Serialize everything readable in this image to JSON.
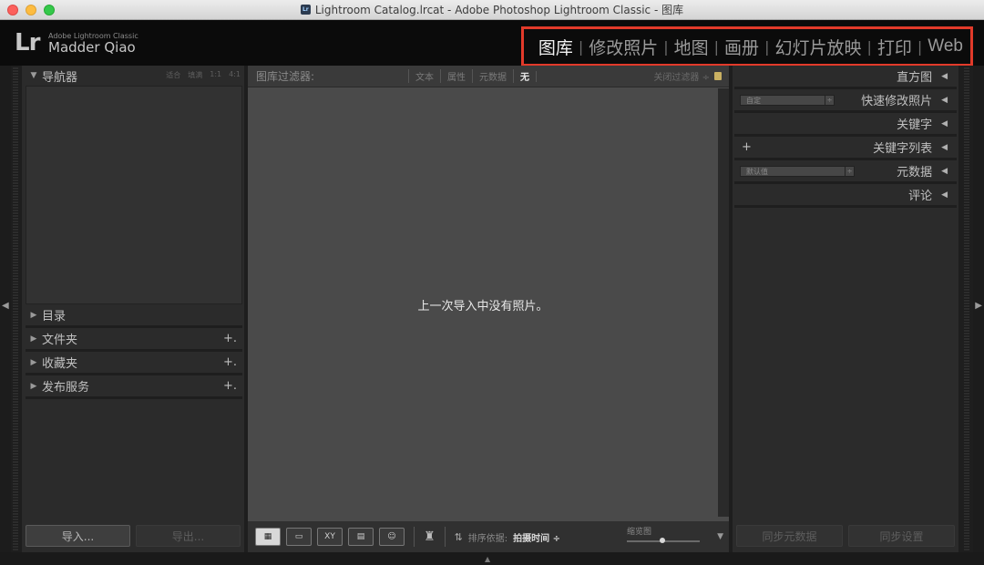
{
  "window": {
    "title": "Lightroom Catalog.lrcat - Adobe Photoshop Lightroom Classic - 图库",
    "icon": "lr-icon"
  },
  "identity": {
    "logo": "Lr",
    "product": "Adobe Lightroom Classic",
    "user": "Madder Qiao"
  },
  "modules": [
    "图库",
    "修改照片",
    "地图",
    "画册",
    "幻灯片放映",
    "打印",
    "Web"
  ],
  "active_module": "图库",
  "left_panel": {
    "navigator": {
      "label": "导航器",
      "options": [
        "适合",
        "填满",
        "1:1",
        "4:1"
      ]
    },
    "sections": [
      {
        "label": "目录",
        "has_add": false
      },
      {
        "label": "文件夹",
        "has_add": true
      },
      {
        "label": "收藏夹",
        "has_add": true
      },
      {
        "label": "发布服务",
        "has_add": true
      }
    ],
    "plus": "+.",
    "import_label": "导入...",
    "export_label": "导出..."
  },
  "filter_bar": {
    "title": "图库过滤器:",
    "options": [
      "文本",
      "属性",
      "元数据",
      "无"
    ],
    "selected": "无",
    "close_label": "关闭过滤器 ÷"
  },
  "center": {
    "empty_message": "上一次导入中没有照片。"
  },
  "toolbar": {
    "view_buttons": [
      "grid-view",
      "loupe-view",
      "compare-view",
      "survey-view",
      "people-view"
    ],
    "compare_text": "XY",
    "sort_label": "排序依据:",
    "sort_value": "拍摄时间 ÷",
    "thumbnail_label": "缩览图",
    "thumbnail_size": 0.45
  },
  "right_panel": {
    "sections": [
      {
        "label": "直方图"
      },
      {
        "label": "快速修改照片",
        "preset": "自定"
      },
      {
        "label": "关键字"
      },
      {
        "label": "关键字列表",
        "plus": "+"
      },
      {
        "label": "元数据",
        "preset": "默认值"
      },
      {
        "label": "评论"
      }
    ],
    "sync_metadata_label": "同步元数据",
    "sync_settings_label": "同步设置"
  },
  "colors": {
    "highlight_box": "#e23a2a",
    "panel_bg": "#2b2b2b",
    "grid_bg": "#4a4a4a"
  }
}
